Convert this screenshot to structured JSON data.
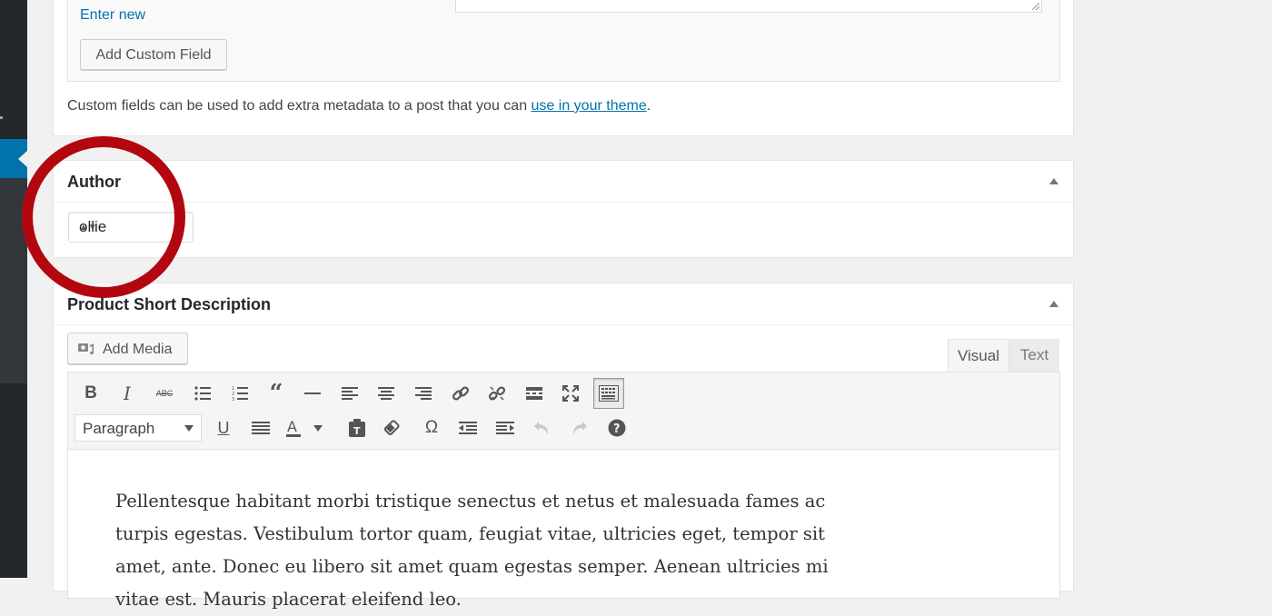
{
  "custom_fields": {
    "enter_new": "Enter new",
    "add_button": "Add Custom Field",
    "note_before": "Custom fields can be used to add extra metadata to a post that you can ",
    "note_link": "use in your theme",
    "note_after": "."
  },
  "author": {
    "title": "Author",
    "selected": "ollie"
  },
  "description": {
    "title": "Product Short Description",
    "add_media": "Add Media",
    "tab_visual": "Visual",
    "tab_text": "Text",
    "format": "Paragraph",
    "body": "Pellentesque habitant morbi tristique senectus et netus et malesuada fames ac turpis egestas. Vestibulum tortor quam, feugiat vitae, ultricies eget, tempor sit amet, ante. Donec eu libero sit amet quam egestas semper. Aenean ultricies mi vitae est. Mauris placerat eleifend leo."
  },
  "toolbar": {
    "row1": [
      "bold-icon",
      "italic-icon",
      "strikethrough-icon",
      "bullet-list-icon",
      "numbered-list-icon",
      "blockquote-icon",
      "horizontal-rule-icon",
      "align-left-icon",
      "align-center-icon",
      "align-right-icon",
      "insert-link-icon",
      "unlink-icon",
      "read-more-icon",
      "fullscreen-icon",
      "toolbar-toggle-icon"
    ],
    "row2": [
      "underline-icon",
      "justify-icon",
      "text-color-icon",
      "paste-as-text-icon",
      "clear-formatting-icon",
      "special-character-icon",
      "outdent-icon",
      "indent-icon",
      "undo-icon",
      "redo-icon",
      "help-icon"
    ]
  },
  "colors": {
    "link": "#0073aa",
    "admin_menu": "#23282d",
    "highlight_circle": "#b2070f"
  }
}
